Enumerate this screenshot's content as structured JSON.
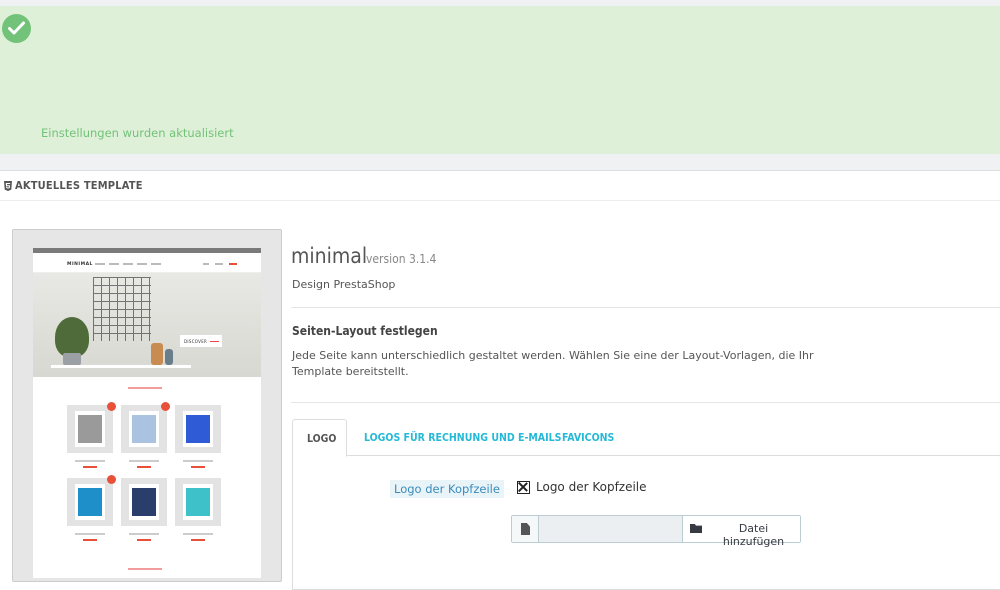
{
  "alert": {
    "message": "Einstellungen wurden aktualisiert",
    "icon": "check-circle-icon",
    "color": "#72c279"
  },
  "panel": {
    "title": "AKTUELLES TEMPLATE",
    "icon": "html5-icon"
  },
  "thumbnail": {
    "logo": "MINIMAL",
    "hero_button": "DISCOVER"
  },
  "theme": {
    "name": "minimal",
    "version": "version 3.1.4",
    "author": "Design PrestaShop"
  },
  "layout": {
    "title": "Seiten-Layout festlegen",
    "description": "Jede Seite kann unterschiedlich gestaltet werden. Wählen Sie eine der Layout-Vorlagen, die Ihr Template bereitstellt."
  },
  "tabs": [
    {
      "label": "LOGO",
      "active": true
    },
    {
      "label": "LOGOS FÜR RECHNUNG UND E-MAILS",
      "active": false
    },
    {
      "label": "FAVICONS",
      "active": false
    }
  ],
  "logo_form": {
    "label": "Logo der Kopfzeile",
    "preview_alt": "Logo der Kopfzeile",
    "file_value": "",
    "add_button": "Datei hinzufügen"
  },
  "colors": {
    "accent": "#25b9d7",
    "success_bg": "#dff0d8",
    "success_text": "#72c279"
  }
}
